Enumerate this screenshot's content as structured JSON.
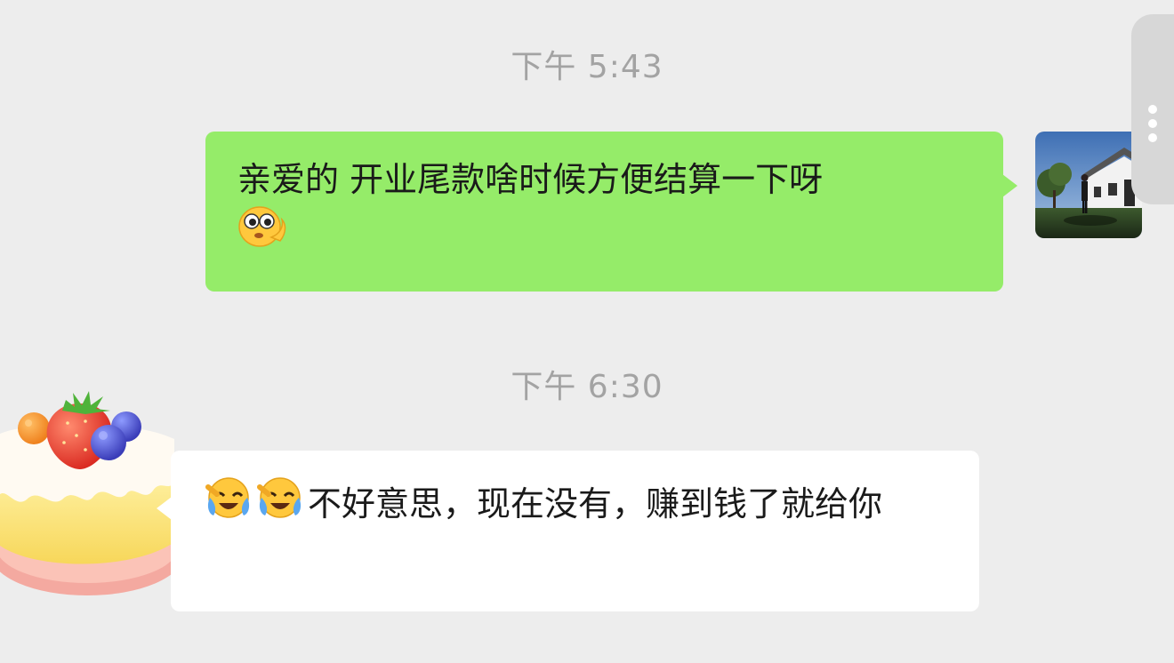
{
  "messages": [
    {
      "timestamp": "下午 5:43",
      "direction": "outgoing",
      "text": "亲爱的 开业尾款啥时候方便结算一下呀",
      "emoji": "peeking-eyes-emoji",
      "bubble_color": "#95ec69"
    },
    {
      "timestamp": "下午 6:30",
      "direction": "incoming",
      "text": "不好意思，现在没有，赚到钱了就给你",
      "emoji": [
        "crying-laughing-emoji",
        "crying-laughing-emoji"
      ],
      "bubble_color": "#ffffff"
    }
  ],
  "avatars": {
    "me": "house-photo-avatar",
    "contact": "strawberry-cake-avatar"
  },
  "colors": {
    "background": "#ededed",
    "timestamp": "#a3a3a3"
  }
}
